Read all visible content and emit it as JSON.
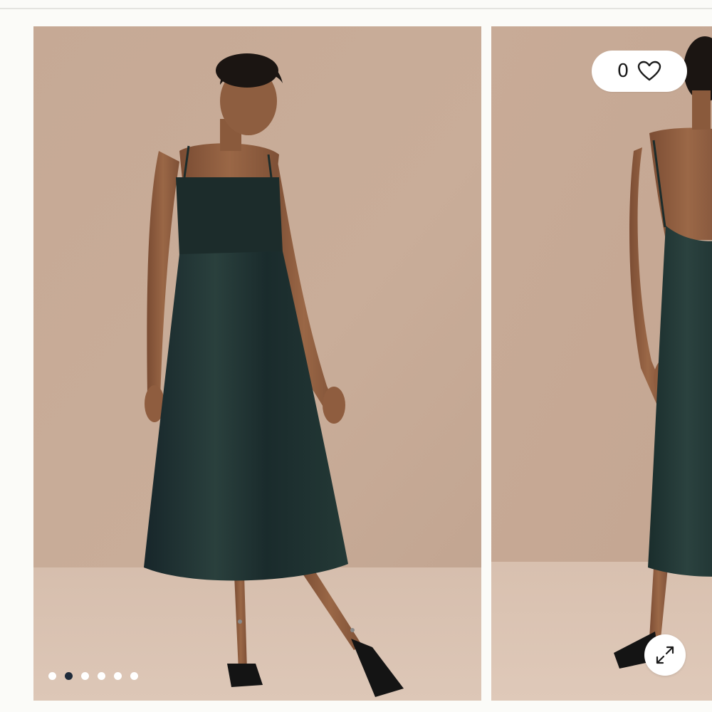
{
  "gallery": {
    "slides": [
      {
        "alt_icon": "product-photo-front"
      },
      {
        "alt_icon": "product-photo-back"
      }
    ],
    "pagination": {
      "total": 6,
      "active_index": 1
    }
  },
  "wishlist": {
    "count": "0",
    "icon": "heart-icon"
  },
  "expand": {
    "icon": "expand-arrows-icon"
  },
  "colors": {
    "background": "#fbfbf8",
    "backdrop_wall": "#c8aa96",
    "floor": "#d8bfae",
    "dress": "#1f3130",
    "skin": "#8a5a3c",
    "dot_active": "#1f2b3a",
    "dot_inactive": "#ffffff"
  }
}
